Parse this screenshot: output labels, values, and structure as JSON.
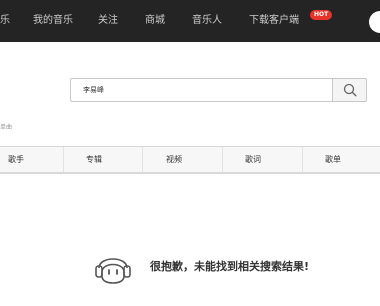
{
  "nav": {
    "items": [
      "乐",
      "我的音乐",
      "关注",
      "商城",
      "音乐人",
      "下载客户端"
    ],
    "hot_badge": "HOT"
  },
  "search": {
    "value": "李易峰",
    "icon": "search-icon"
  },
  "result_note": "单曲",
  "tabs": [
    "歌手",
    "专辑",
    "视频",
    "歌词",
    "歌单"
  ],
  "empty_state": {
    "message": "很抱歉，未能找到相关搜索结果!",
    "icon": "headphone-face-icon"
  },
  "colors": {
    "topbar": "#242424",
    "hot": "#e8332a"
  }
}
